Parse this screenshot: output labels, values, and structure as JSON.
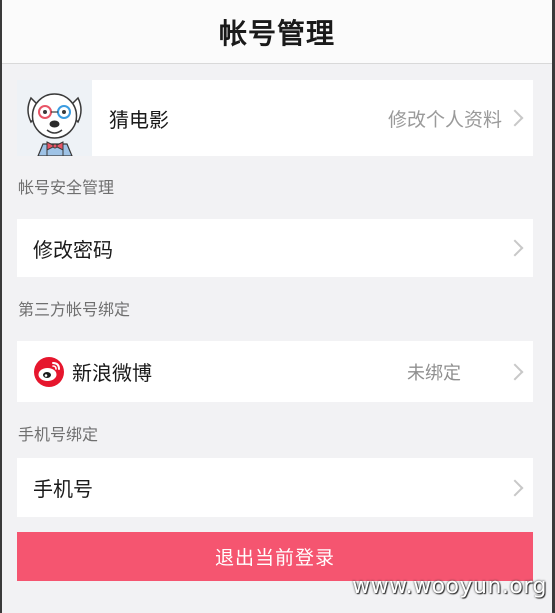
{
  "header": {
    "title": "帐号管理"
  },
  "profile": {
    "name": "猜电影",
    "edit_label": "修改个人资料"
  },
  "security": {
    "section_label": "帐号安全管理",
    "change_password_label": "修改密码"
  },
  "third_party": {
    "section_label": "第三方帐号绑定",
    "weibo_label": "新浪微博",
    "weibo_status": "未绑定"
  },
  "phone": {
    "section_label": "手机号绑定",
    "phone_label": "手机号"
  },
  "logout": {
    "label": "退出当前登录"
  },
  "watermark": {
    "text": "www.wooyun.org"
  },
  "colors": {
    "accent": "#f55570",
    "weibo": "#e6162d",
    "background": "#f2f2f4"
  }
}
